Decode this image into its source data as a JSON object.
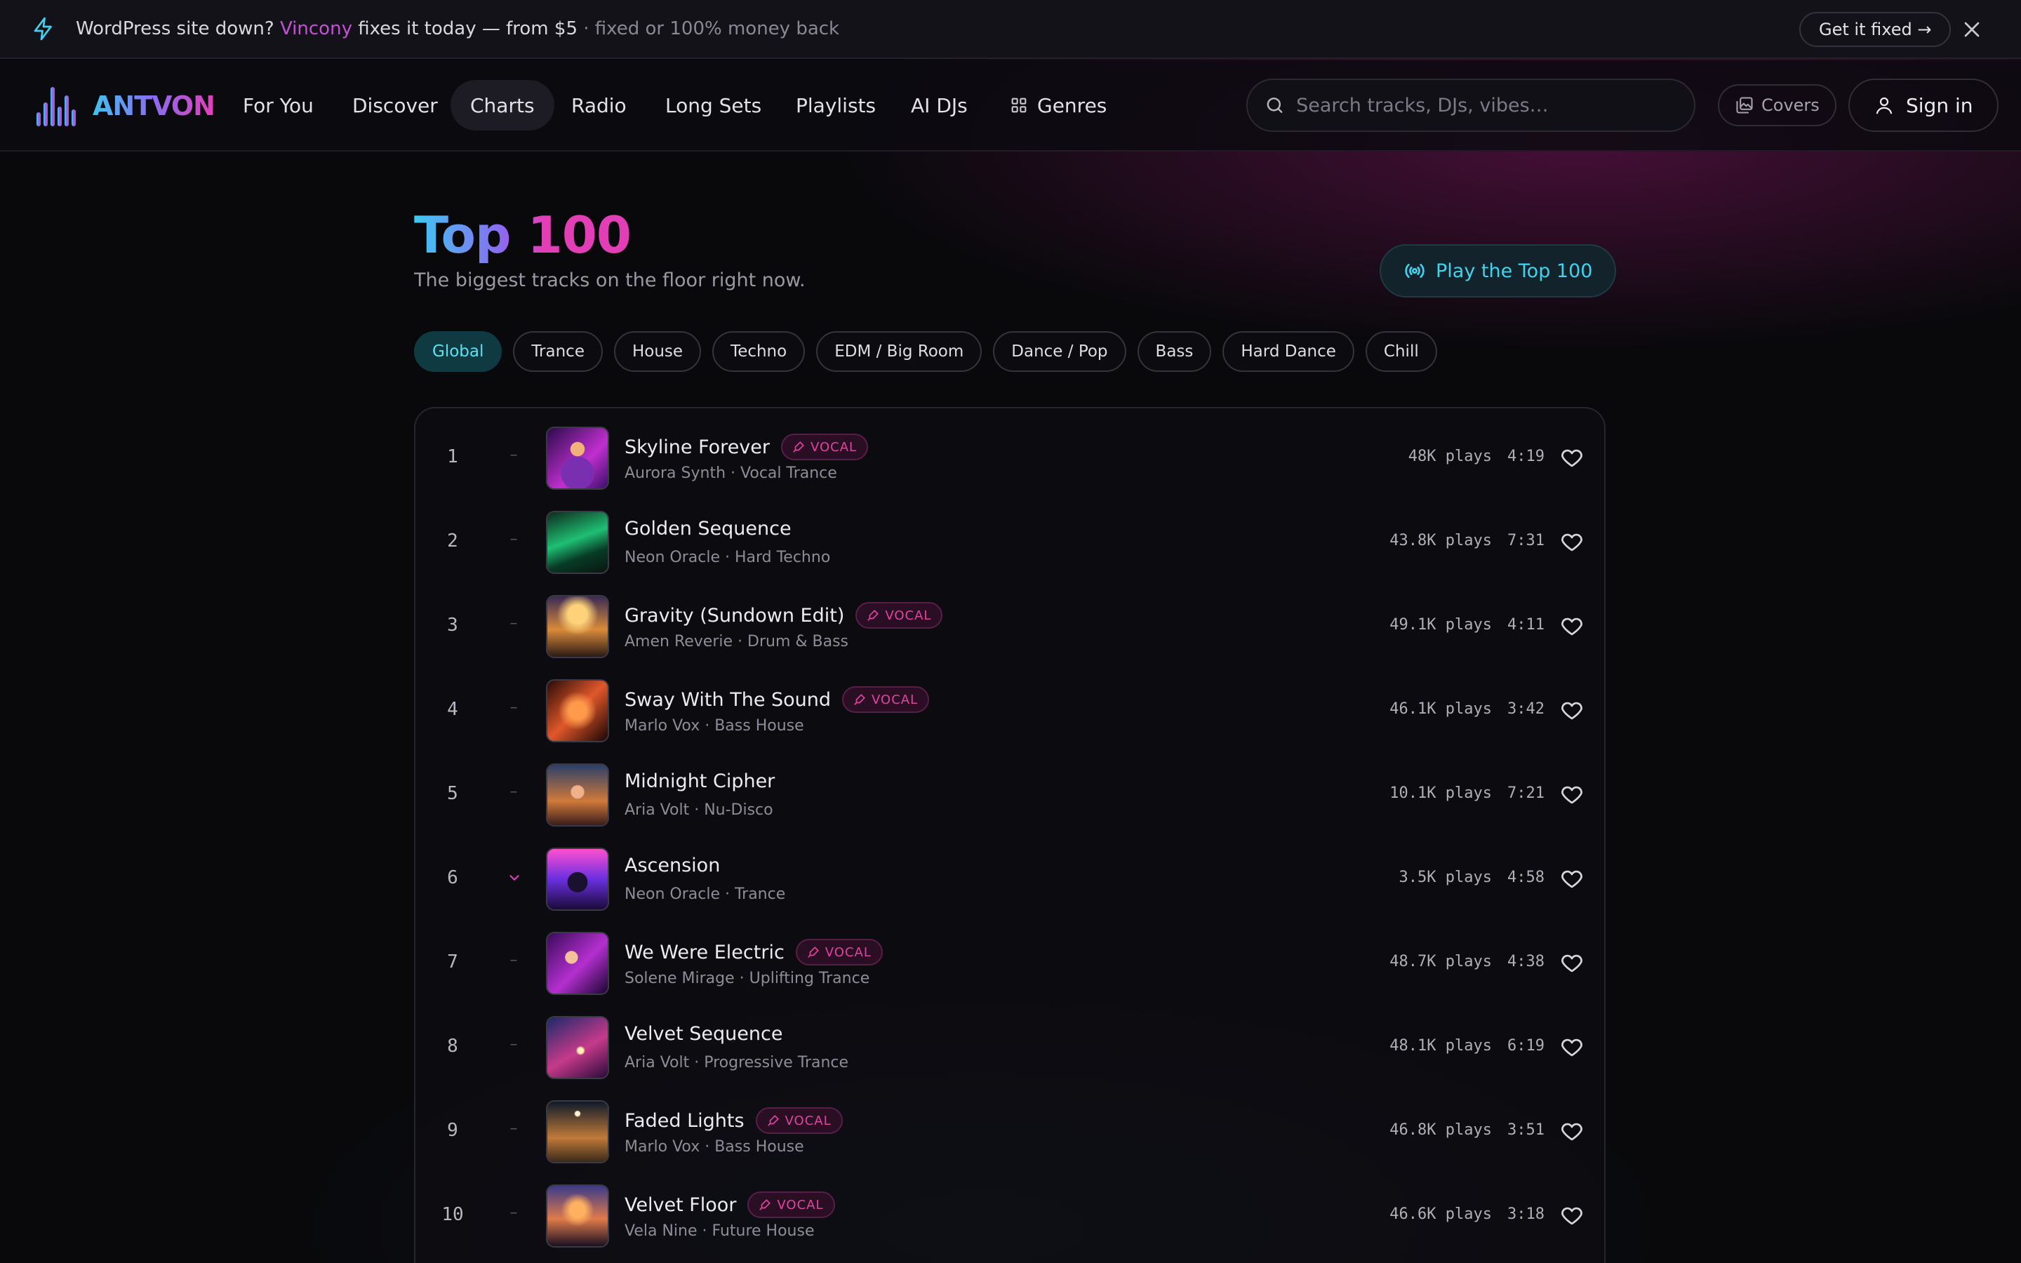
{
  "promo": {
    "prefix": "WordPress site down?",
    "brand": "Vincony",
    "middle": "fixes it today — from $5",
    "suffix": "· fixed or 100% money back",
    "cta": "Get it fixed →"
  },
  "nav": {
    "logo_text": "ANTVON",
    "items": [
      "For You",
      "Discover",
      "Charts",
      "Radio",
      "Long Sets",
      "Playlists",
      "AI DJs",
      "Genres"
    ],
    "active": "Charts",
    "search_placeholder": "Search tracks, DJs, vibes…",
    "covers_label": "Covers",
    "signin_label": "Sign in"
  },
  "hero": {
    "title_a": "Top",
    "title_b": "100",
    "subtitle": "The biggest tracks on the floor right now.",
    "play_label": "Play the Top 100"
  },
  "genres": {
    "items": [
      "Global",
      "Trance",
      "House",
      "Techno",
      "EDM / Big Room",
      "Dance / Pop",
      "Bass",
      "Hard Dance",
      "Chill"
    ],
    "active": "Global"
  },
  "vocal_label": "VOCAL",
  "tracks": [
    {
      "rank": "1",
      "move": "–",
      "title": "Skyline Forever",
      "vocal": true,
      "meta": "Aurora Synth · Vocal Trance",
      "plays": "48K plays",
      "duration": "4:19",
      "cover_icon": "cover-singer-purple"
    },
    {
      "rank": "2",
      "move": "–",
      "title": "Golden Sequence",
      "vocal": false,
      "meta": "Neon Oracle · Hard Techno",
      "plays": "43.8K plays",
      "duration": "7:31",
      "cover_icon": "cover-dj-green"
    },
    {
      "rank": "3",
      "move": "–",
      "title": "Gravity (Sundown Edit)",
      "vocal": true,
      "meta": "Amen Reverie · Drum & Bass",
      "plays": "49.1K plays",
      "duration": "4:11",
      "cover_icon": "cover-couple-sunset"
    },
    {
      "rank": "4",
      "move": "–",
      "title": "Sway With The Sound",
      "vocal": true,
      "meta": "Marlo Vox · Bass House",
      "plays": "46.1K plays",
      "duration": "3:42",
      "cover_icon": "cover-fire-swirl"
    },
    {
      "rank": "5",
      "move": "–",
      "title": "Midnight Cipher",
      "vocal": false,
      "meta": "Aria Volt · Nu-Disco",
      "plays": "10.1K plays",
      "duration": "7:21",
      "cover_icon": "cover-dancer-city"
    },
    {
      "rank": "6",
      "move": "down",
      "title": "Ascension",
      "vocal": false,
      "meta": "Neon Oracle · Trance",
      "plays": "3.5K plays",
      "duration": "4:58",
      "cover_icon": "cover-stage-silhouette"
    },
    {
      "rank": "7",
      "move": "–",
      "title": "We Were Electric",
      "vocal": true,
      "meta": "Solene Mirage · Uplifting Trance",
      "plays": "48.7K plays",
      "duration": "4:38",
      "cover_icon": "cover-crowd-purple"
    },
    {
      "rank": "8",
      "move": "–",
      "title": "Velvet Sequence",
      "vocal": false,
      "meta": "Aria Volt · Progressive Trance",
      "plays": "48.1K plays",
      "duration": "6:19",
      "cover_icon": "cover-friends-sparkler"
    },
    {
      "rank": "9",
      "move": "–",
      "title": "Faded Lights",
      "vocal": true,
      "meta": "Marlo Vox · Bass House",
      "plays": "46.8K plays",
      "duration": "3:51",
      "cover_icon": "cover-pool-lights"
    },
    {
      "rank": "10",
      "move": "–",
      "title": "Velvet Floor",
      "vocal": true,
      "meta": "Vela Nine · Future House",
      "plays": "46.6K plays",
      "duration": "3:18",
      "cover_icon": "cover-beach-sunset"
    }
  ],
  "colors": {
    "accent_cyan": "#3fd3ef",
    "accent_magenta": "#e23fb6",
    "background": "#09090c"
  }
}
